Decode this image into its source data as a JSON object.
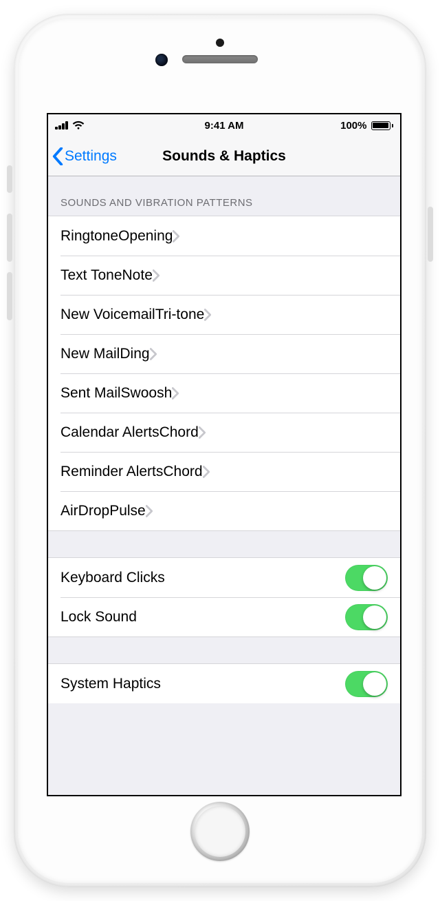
{
  "statusbar": {
    "time": "9:41 AM",
    "battery_text": "100%"
  },
  "nav": {
    "back_label": "Settings",
    "title": "Sounds & Haptics"
  },
  "sections": {
    "patterns_header": "SOUNDS AND VIBRATION PATTERNS",
    "patterns": [
      {
        "label": "Ringtone",
        "value": "Opening"
      },
      {
        "label": "Text Tone",
        "value": "Note"
      },
      {
        "label": "New Voicemail",
        "value": "Tri-tone"
      },
      {
        "label": "New Mail",
        "value": "Ding"
      },
      {
        "label": "Sent Mail",
        "value": "Swoosh"
      },
      {
        "label": "Calendar Alerts",
        "value": "Chord"
      },
      {
        "label": "Reminder Alerts",
        "value": "Chord"
      },
      {
        "label": "AirDrop",
        "value": "Pulse"
      }
    ],
    "toggles_a": [
      {
        "label": "Keyboard Clicks",
        "on": true
      },
      {
        "label": "Lock Sound",
        "on": true
      }
    ],
    "toggles_b": [
      {
        "label": "System Haptics",
        "on": true
      }
    ]
  }
}
